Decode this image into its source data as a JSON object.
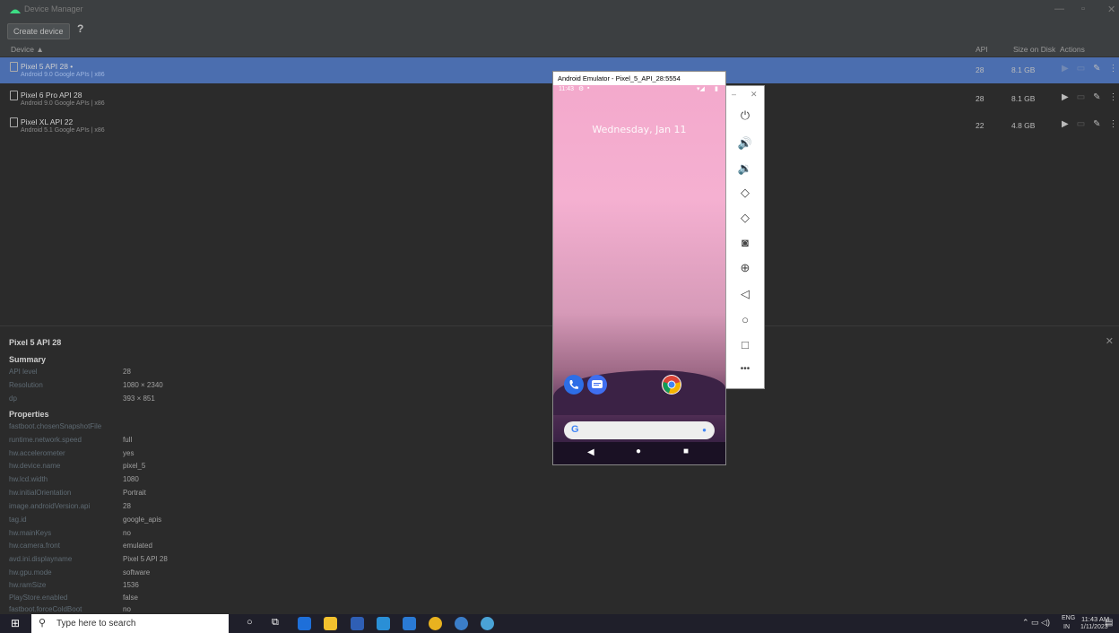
{
  "window": {
    "title": "Device Manager"
  },
  "toolbar": {
    "create_label": "Create device",
    "help_label": "?"
  },
  "columns": {
    "device": "Device ▲",
    "api": "API",
    "size": "Size on Disk",
    "actions": "Actions"
  },
  "devices": [
    {
      "name": "Pixel 5 API 28 •",
      "sub": "Android 9.0 Google APIs | x86",
      "api": "28",
      "size": "8.1 GB",
      "selected": true
    },
    {
      "name": "Pixel 6 Pro API 28",
      "sub": "Android 9.0 Google APIs | x86",
      "api": "28",
      "size": "8.1 GB",
      "selected": false
    },
    {
      "name": "Pixel XL API 22",
      "sub": "Android 5.1 Google APIs | x86",
      "api": "22",
      "size": "4.8 GB",
      "selected": false
    }
  ],
  "details": {
    "title": "Pixel 5 API 28",
    "summary_label": "Summary",
    "summary": [
      {
        "k": "API level",
        "v": "28"
      },
      {
        "k": "Resolution",
        "v": "1080 × 2340"
      },
      {
        "k": "dp",
        "v": "393 × 851"
      }
    ],
    "properties_label": "Properties",
    "properties": [
      {
        "k": "fastboot.chosenSnapshotFile",
        "v": ""
      },
      {
        "k": "runtime.network.speed",
        "v": "full"
      },
      {
        "k": "hw.accelerometer",
        "v": "yes"
      },
      {
        "k": "hw.device.name",
        "v": "pixel_5"
      },
      {
        "k": "hw.lcd.width",
        "v": "1080"
      },
      {
        "k": "hw.initialOrientation",
        "v": "Portrait"
      },
      {
        "k": "image.androidVersion.api",
        "v": "28"
      },
      {
        "k": "tag.id",
        "v": "google_apis"
      },
      {
        "k": "hw.mainKeys",
        "v": "no"
      },
      {
        "k": "hw.camera.front",
        "v": "emulated"
      },
      {
        "k": "avd.ini.displayname",
        "v": "Pixel 5 API 28"
      },
      {
        "k": "hw.gpu.mode",
        "v": "software"
      },
      {
        "k": "hw.ramSize",
        "v": "1536"
      },
      {
        "k": "PlayStore.enabled",
        "v": "false"
      },
      {
        "k": "fastboot.forceColdBoot",
        "v": "no"
      }
    ]
  },
  "emulator": {
    "title": "Android Emulator - Pixel_5_API_28:5554",
    "time": "11:43",
    "date": "Wednesday, Jan 11",
    "search_logo": "G"
  },
  "taskbar": {
    "search_placeholder": "Type here to search",
    "lang": "ENG",
    "region": "IN",
    "time": "11:43 AM",
    "date": "1/11/2023"
  }
}
